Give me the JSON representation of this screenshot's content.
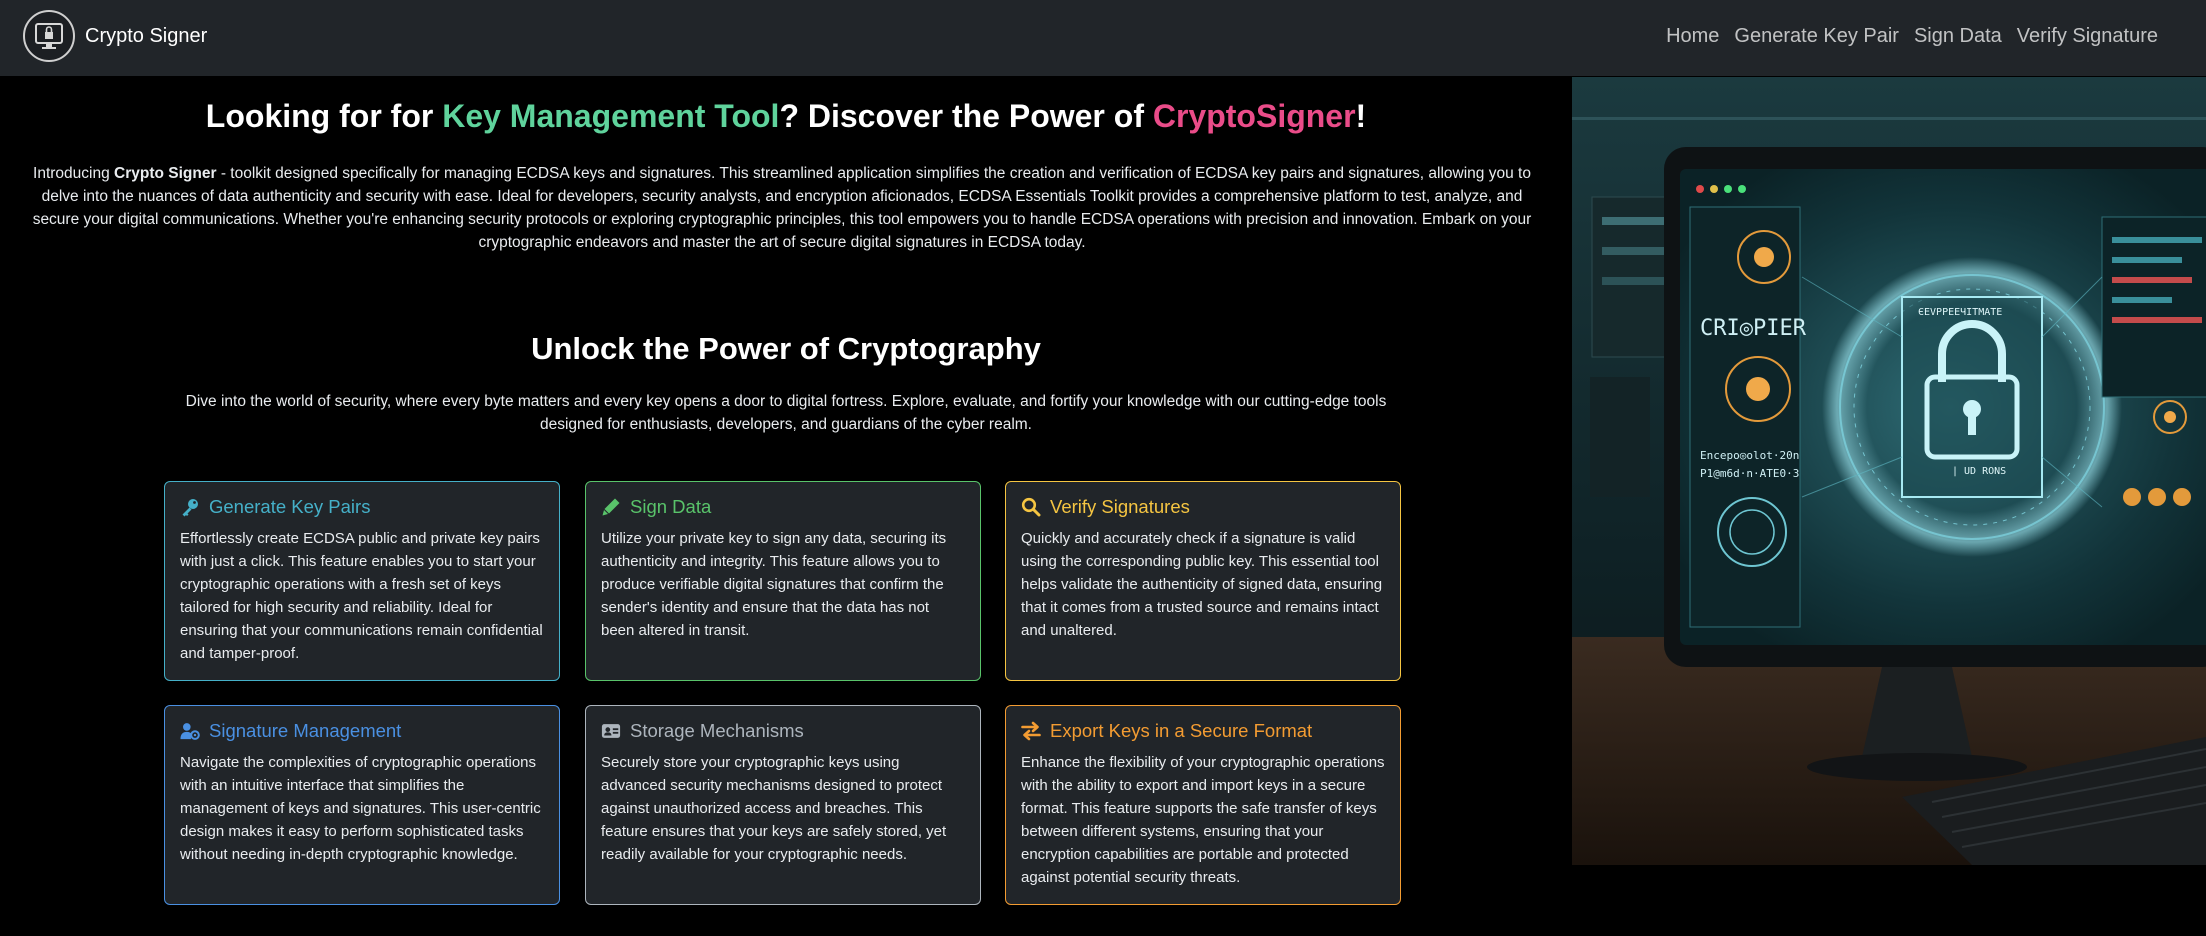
{
  "nav": {
    "brand": "Crypto Signer",
    "links": [
      "Home",
      "Generate Key Pair",
      "Sign Data",
      "Verify Signature"
    ]
  },
  "hero": {
    "title_pre": "Looking for for ",
    "title_hl1": "Key Management Tool",
    "title_mid": "? Discover the Power of ",
    "title_hl2": "CryptoSigner",
    "title_post": "!",
    "intro_pre": "Introducing ",
    "intro_bold": "Crypto Signer",
    "intro_rest": " - toolkit designed specifically for managing ECDSA keys and signatures. This streamlined application simplifies the creation and verification of ECDSA key pairs and signatures, allowing you to delve into the nuances of data authenticity and security with ease. Ideal for developers, security analysts, and encryption aficionados, ECDSA Essentials Toolkit provides a comprehensive platform to test, analyze, and secure your digital communications. Whether you're enhancing security protocols or exploring cryptographic principles, this tool empowers you to handle ECDSA operations with precision and innovation. Embark on your cryptographic endeavors and master the art of secure digital signatures in ECDSA today."
  },
  "section": {
    "title": "Unlock the Power of Cryptography",
    "subtitle": "Dive into the world of security, where every byte matters and every key opens a door to digital fortress. Explore, evaluate, and fortify your knowledge with our cutting-edge tools designed for enthusiasts, developers, and guardians of the cyber realm."
  },
  "cards": [
    {
      "title": "Generate Key Pairs",
      "icon": "key-icon",
      "color": "#45b0c8",
      "text": "Effortlessly create ECDSA public and private key pairs with just a click. This feature enables you to start your cryptographic operations with a fresh set of keys tailored for high security and reliability. Ideal for ensuring that your communications remain confidential and tamper-proof."
    },
    {
      "title": "Sign Data",
      "icon": "pen-icon",
      "color": "#59c36a",
      "text": "Utilize your private key to sign any data, securing its authenticity and integrity. This feature allows you to produce verifiable digital signatures that confirm the sender's identity and ensure that the data has not been altered in transit."
    },
    {
      "title": "Verify Signatures",
      "icon": "search-icon",
      "color": "#f5c542",
      "text": "Quickly and accurately check if a signature is valid using the corresponding public key. This essential tool helps validate the authenticity of signed data, ensuring that it comes from a trusted source and remains intact and unaltered."
    },
    {
      "title": "Signature Management",
      "icon": "user-gear-icon",
      "color": "#4a90e2",
      "text": "Navigate the complexities of cryptographic operations with an intuitive interface that simplifies the management of keys and signatures. This user-centric design makes it easy to perform sophisticated tasks without needing in-depth cryptographic knowledge."
    },
    {
      "title": "Storage Mechanisms",
      "icon": "id-card-icon",
      "color": "#adb5bd",
      "text": "Securely store your cryptographic keys using advanced security mechanisms designed to protect against unauthorized access and breaches. This feature ensures that your keys are safely stored, yet readily available for your cryptographic needs."
    },
    {
      "title": "Export Keys in a Secure Format",
      "icon": "exchange-icon",
      "color": "#f39c32",
      "text": "Enhance the flexibility of your cryptographic operations with the ability to export and import keys in a secure format. This feature supports the safe transfer of keys between different systems, ensuring that your encryption capabilities are portable and protected against potential security threats."
    }
  ]
}
